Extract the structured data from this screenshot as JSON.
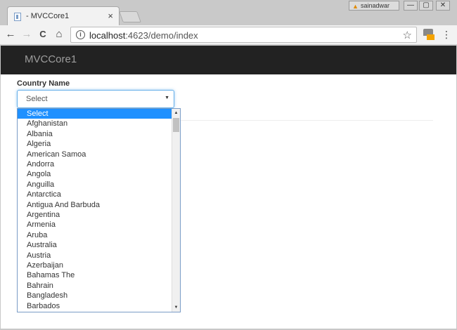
{
  "browser": {
    "tab_title": "- MVCCore1",
    "tab_close": "×",
    "user_badge": "sainadwar",
    "warn_glyph": "▲",
    "window_controls": {
      "minimize": "—",
      "restore": "▢",
      "close": "✕"
    },
    "nav": {
      "back": "←",
      "forward": "→",
      "reload": "C",
      "home": "⌂"
    },
    "url_host": "localhost",
    "url_path": ":4623/demo/index",
    "info_glyph": "i",
    "star_glyph": "☆",
    "menu_glyph": "⋮"
  },
  "page": {
    "brand": "MVCCore1",
    "field_label": "Country Name",
    "select": {
      "value": "Select",
      "caret": "▼"
    },
    "options": [
      "Select",
      "Afghanistan",
      "Albania",
      "Algeria",
      "American Samoa",
      "Andorra",
      "Angola",
      "Anguilla",
      "Antarctica",
      "Antigua And Barbuda",
      "Argentina",
      "Armenia",
      "Aruba",
      "Australia",
      "Austria",
      "Azerbaijan",
      "Bahamas The",
      "Bahrain",
      "Bangladesh",
      "Barbados"
    ],
    "selected_index": 0,
    "scroll": {
      "up": "▲",
      "down": "▼"
    }
  },
  "colors": {
    "navbar": "#222222",
    "brand": "#9d9d9d",
    "selected": "#1e90ff",
    "focus": "#66afe9"
  }
}
